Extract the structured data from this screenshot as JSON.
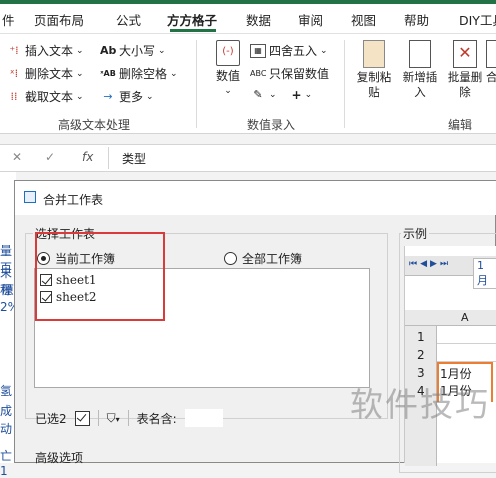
{
  "tabs": [
    "件",
    "页面布局",
    "公式",
    "方方格子",
    "数据",
    "审阅",
    "视图",
    "帮助",
    "DIY工具"
  ],
  "ribbon": {
    "text_group": {
      "insert_text": "插入文本",
      "delete_text": "删除文本",
      "truncate_text": "截取文本",
      "case": "大小写",
      "delete_spaces": "删除空格",
      "more": "更多",
      "label": "高级文本处理"
    },
    "numeric_group": {
      "value": "数值",
      "round": "四舍五入",
      "keep_value": "只保留数值",
      "label": "数值录入"
    },
    "edit_group": {
      "copy_paste": "复制粘贴",
      "add_insert": "新增插入",
      "batch_delete": "批量删除",
      "merge": "合并转",
      "label": "编辑"
    }
  },
  "formula_bar": {
    "fx": "fx",
    "content": "类型"
  },
  "sheet_left_fragments": [
    "量百",
    "末程",
    "原",
    "2%",
    "氢",
    "成",
    "动",
    "亡1"
  ],
  "dialog": {
    "title": "合并工作表",
    "select_group_label": "选择工作表",
    "radio_current": "当前工作簿",
    "radio_all": "全部工作簿",
    "sheets": [
      "sheet1",
      "sheet2"
    ],
    "selected_label": "已选2",
    "sheetname_label": "表名含:",
    "advanced_label": "高级选项",
    "example_label": "示例"
  },
  "preview": {
    "sheet_tab": "1月",
    "col_header": "A",
    "row_headers": [
      "1",
      "2",
      "3",
      "4"
    ],
    "cells": [
      "",
      "",
      "1月份",
      "1月份"
    ]
  },
  "watermark": "软件技巧"
}
